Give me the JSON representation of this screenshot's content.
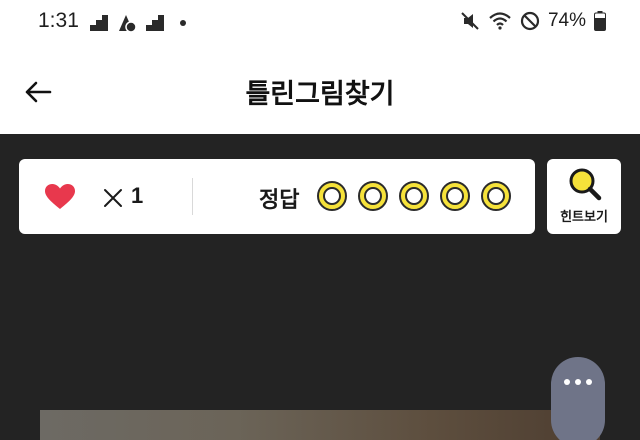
{
  "status_bar": {
    "time": "1:31",
    "battery_percent": "74%",
    "icons": [
      "signal-icon",
      "notification-app-icon",
      "signal-icon",
      "dot-icon",
      "mute-icon",
      "wifi-icon",
      "do-not-disturb-icon",
      "battery-icon"
    ]
  },
  "app_bar": {
    "title": "틀린그림찾기",
    "back_icon": "arrow-left-icon"
  },
  "status_panel": {
    "lives_icon": "heart-icon",
    "multiply_symbol": "✕",
    "lives_count": "1",
    "answer_label": "정답",
    "answer_slots_total": 5,
    "answers_found": 0
  },
  "hint": {
    "label": "힌트보기",
    "icon": "magnifier-icon"
  },
  "floating_menu": {
    "icon": "more-horizontal-icon"
  },
  "colors": {
    "background": "#232323",
    "panel": "#ffffff",
    "heart": "#e8384d",
    "answer_circle": "#f6e23a",
    "fab": "#6f7488"
  }
}
